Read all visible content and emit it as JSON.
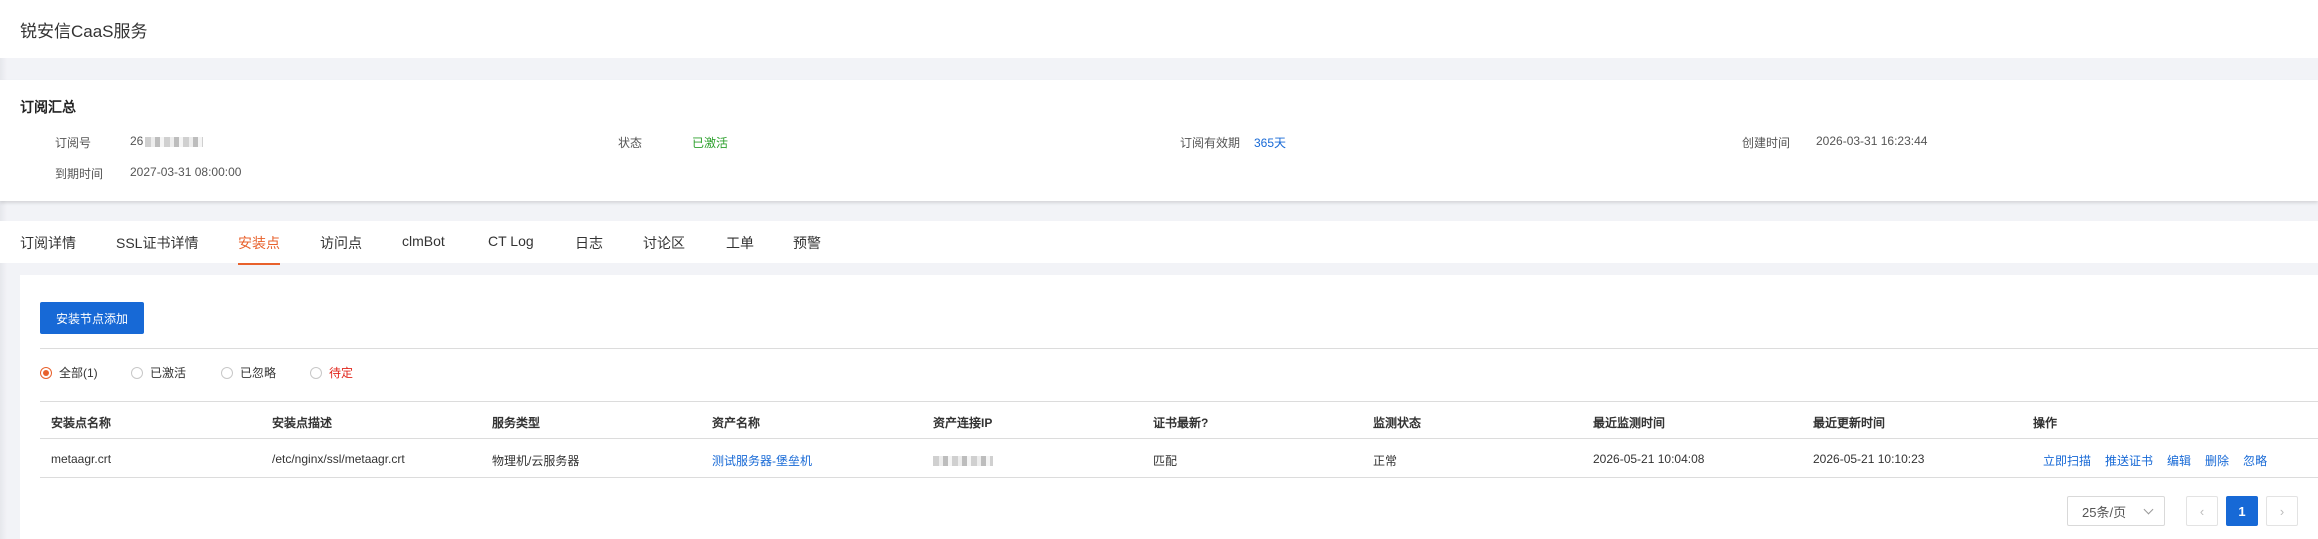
{
  "app": {
    "title": "锐安信CaaS服务"
  },
  "summary": {
    "heading": "订阅汇总",
    "fields": [
      {
        "label": "订阅号",
        "value": "26"
      },
      {
        "label": "状态",
        "value": "已激活"
      },
      {
        "label": "订阅有效期",
        "value": "365天"
      },
      {
        "label": "创建时间",
        "value": "2026-03-31 16:23:44"
      },
      {
        "label": "到期时间",
        "value": "2027-03-31 08:00:00"
      }
    ],
    "colors": {
      "status": "#2ca02c",
      "validity": "#1769d6"
    }
  },
  "tabs": [
    {
      "label": "订阅详情"
    },
    {
      "label": "SSL证书详情"
    },
    {
      "label": "安装点",
      "active": true
    },
    {
      "label": "访问点"
    },
    {
      "label": "clmBot"
    },
    {
      "label": "CT Log"
    },
    {
      "label": "日志"
    },
    {
      "label": "讨论区"
    },
    {
      "label": "工单"
    },
    {
      "label": "预警"
    }
  ],
  "panel": {
    "add_button": "安装节点添加",
    "filters": [
      {
        "label": "全部(1)",
        "checked": true
      },
      {
        "label": "已激活"
      },
      {
        "label": "已忽略"
      },
      {
        "label": "待定"
      }
    ],
    "table": {
      "columns": [
        "安装点名称",
        "安装点描述",
        "服务类型",
        "资产名称",
        "资产连接IP",
        "证书最新?",
        "监测状态",
        "最近监测时间",
        "最近更新时间",
        "操作"
      ],
      "rows": [
        {
          "name": "metaagr.crt",
          "desc": "/etc/nginx/ssl/metaagr.crt",
          "service": "物理机/云服务器",
          "asset": "测试服务器-堡垒机",
          "ip": "",
          "cert_latest": "匹配",
          "monitor": "正常",
          "last_check": "2026-05-21 10:04:08",
          "last_update": "2026-05-21 10:10:23",
          "actions": [
            "立即扫描",
            "推送证书",
            "编辑",
            "删除",
            "忽略"
          ]
        }
      ]
    },
    "pagination": {
      "page_size": "25条/页",
      "prev": "‹",
      "current": "1",
      "next": "›"
    }
  },
  "colors": {
    "accent": "#1769d6",
    "active_tab": "#e8612c",
    "ok": "#2ca02c",
    "pending": "#e1261c"
  }
}
